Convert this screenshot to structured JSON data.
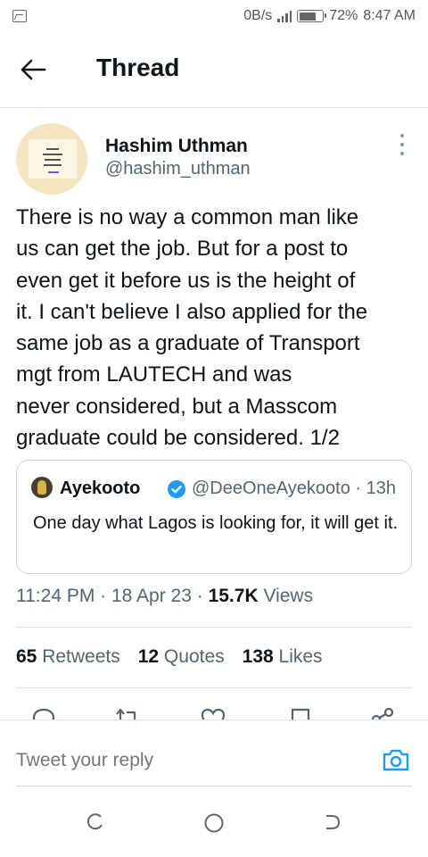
{
  "status_bar": {
    "data_rate": "0B/s",
    "battery": "72%",
    "battery_level": 0.72,
    "time": "8:47 AM",
    "icons": [
      "image-icon",
      "signal-icon",
      "battery-icon"
    ]
  },
  "header": {
    "title": "Thread",
    "back_icon": "arrow-left-icon"
  },
  "author": {
    "name": "Hashim Uthman",
    "handle": "@hashim_uthman",
    "more_icon": "more-vertical-icon"
  },
  "tweet": {
    "lines": [
      "There is no way a common man like",
      "us can get the job. But for a post to",
      "even get it before us is the height of",
      "it. I can't believe I also applied for the",
      "same job as a graduate of Transport",
      "mgt from LAUTECH and was",
      "never considered, but a Masscom",
      "graduate could be considered. 1/2"
    ]
  },
  "quote": {
    "name": "Ayekooto",
    "meta": "@DeeOneAyekooto · 13h",
    "text": "One day what Lagos is looking for, it will get it.",
    "verified_color": "#1d9bf0"
  },
  "timestamp": {
    "time": "11:24 PM",
    "sep1": " · ",
    "date": "18 Apr 23",
    "sep2": " · ",
    "views_count": "15.7K",
    "views_label": " Views"
  },
  "stats": [
    {
      "count": "65",
      "label": " Retweets"
    },
    {
      "count": "12",
      "label": " Quotes"
    },
    {
      "count": "138",
      "label": " Likes"
    }
  ],
  "actions": [
    "reply-icon",
    "retweet-icon",
    "like-icon",
    "bookmark-icon",
    "share-icon"
  ],
  "reply": {
    "placeholder": "Tweet your reply",
    "camera_icon": "camera-icon",
    "accent": "#1d9bf0"
  },
  "navbar": [
    "recents-icon",
    "home-icon",
    "back-icon"
  ]
}
